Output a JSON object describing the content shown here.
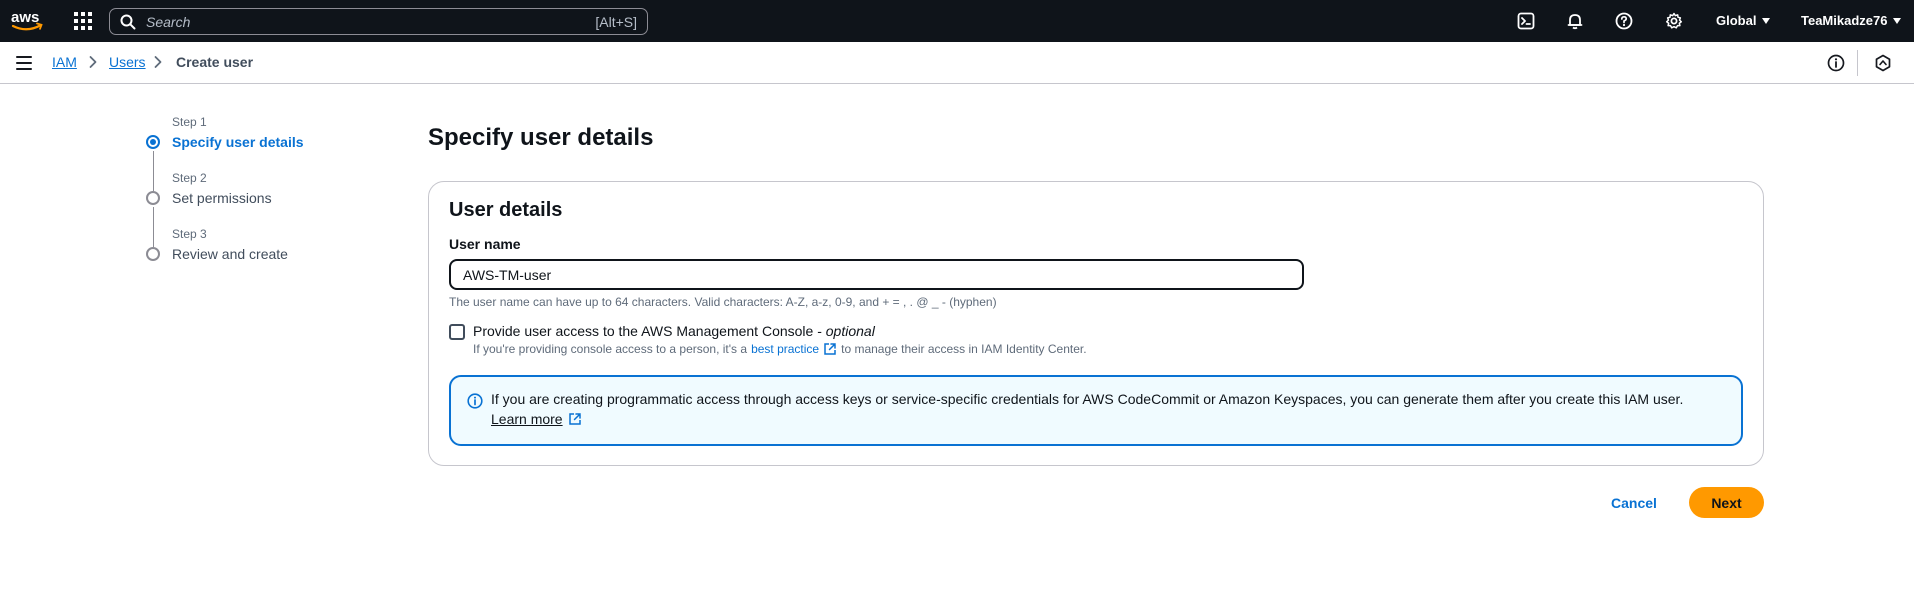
{
  "topnav": {
    "logo_text": "aws",
    "search": {
      "placeholder": "Search",
      "shortcut": "[Alt+S]"
    },
    "icons": [
      "cloudshell-icon",
      "bell-icon",
      "help-icon",
      "gear-icon"
    ],
    "region": "Global",
    "account": "TeaMikadze76"
  },
  "breadcrumb": {
    "items": [
      {
        "label": "IAM"
      },
      {
        "label": "Users"
      },
      {
        "label": "Create user"
      }
    ]
  },
  "steps": [
    {
      "step": "Step 1",
      "title": "Specify user details",
      "active": true
    },
    {
      "step": "Step 2",
      "title": "Set permissions",
      "active": false
    },
    {
      "step": "Step 3",
      "title": "Review and create",
      "active": false
    }
  ],
  "main": {
    "page_title": "Specify user details",
    "card_title": "User details",
    "user_name_label": "User name",
    "user_name_value": "AWS-TM-user",
    "user_name_hint": "The user name can have up to 64 characters. Valid characters: A-Z, a-z, 0-9, and + = , . @ _ - (hyphen)",
    "console_access": {
      "label": "Provide user access to the AWS Management Console - ",
      "optional": "optional",
      "checked": false,
      "desc_prefix": "If you're providing console access to a person, it's a ",
      "desc_link": "best practice",
      "desc_suffix": " to manage their access in IAM Identity Center."
    },
    "alert": {
      "text": "If you are creating programmatic access through access keys or service-specific credentials for AWS CodeCommit or Amazon Keyspaces, you can generate them after you create this IAM user.",
      "link": "Learn more"
    },
    "cancel_label": "Cancel",
    "next_label": "Next"
  },
  "colors": {
    "nav_bg": "#0f141a",
    "link": "#0972d3",
    "primary_button": "#ff9900",
    "alert_bg": "#f0fbff"
  }
}
